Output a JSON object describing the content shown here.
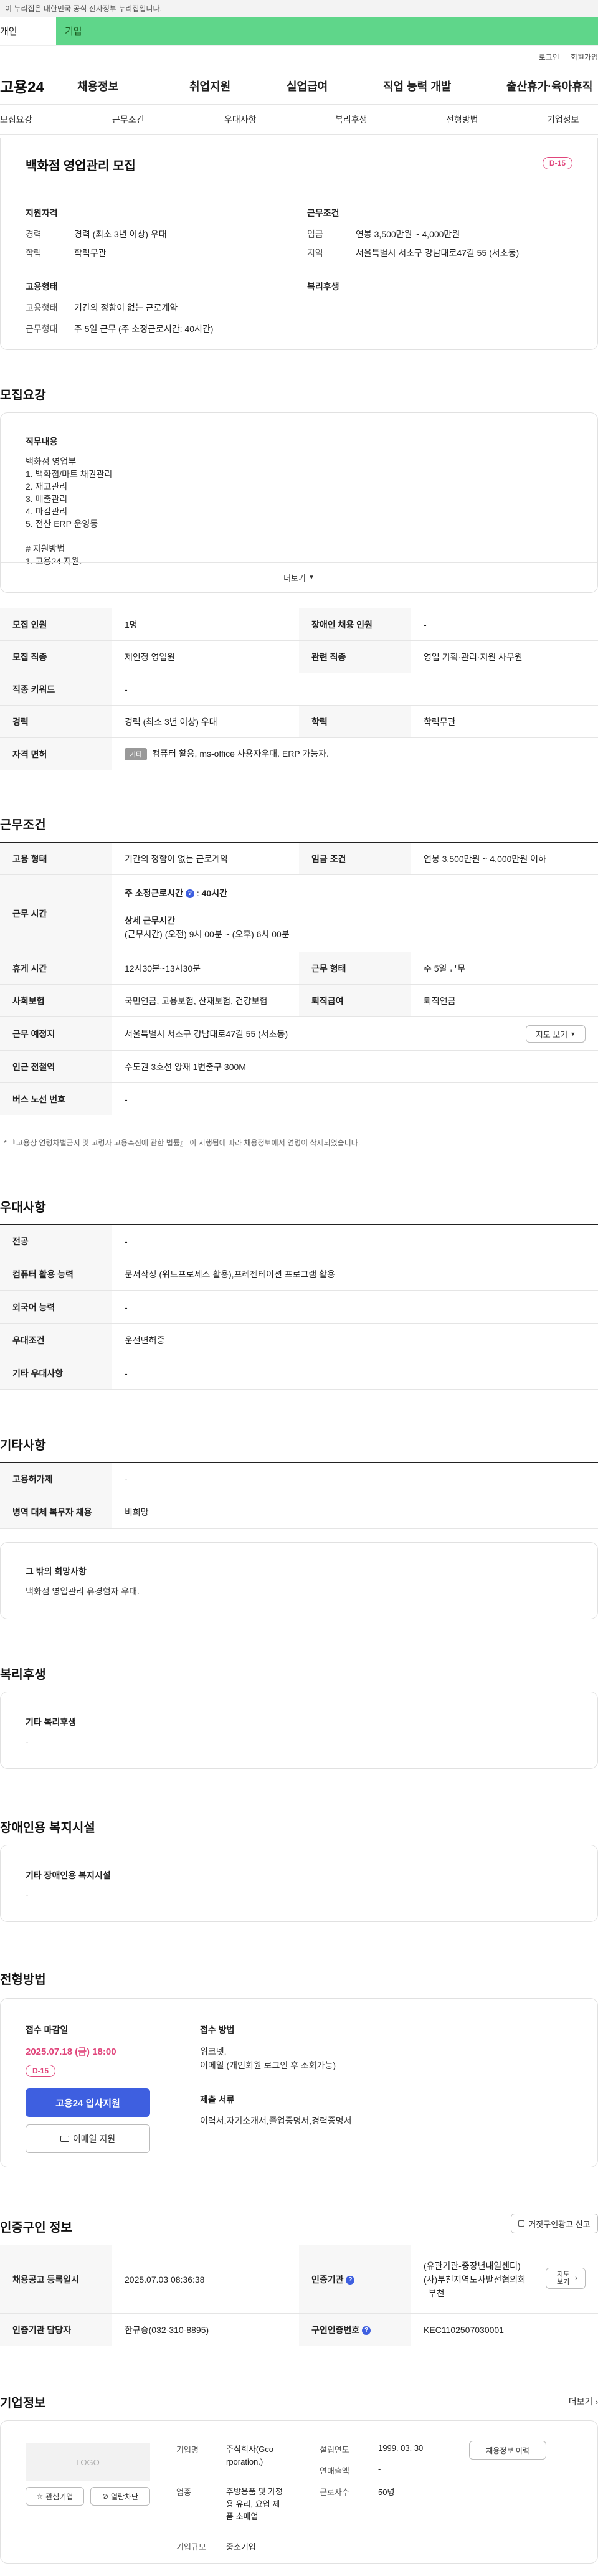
{
  "gov_banner": "이 누리집은 대한민국 공식 전자정부 누리집입니다.",
  "top_tabs": [
    {
      "label": "개인"
    },
    {
      "label": "기업"
    }
  ],
  "util_links": {
    "login": "로그인",
    "signup": "회원가입"
  },
  "gnb": {
    "logo": "고용24",
    "items": [
      "채용정보",
      "취업지원",
      "실업급여",
      "직업 능력 개발",
      "출산휴가·육아휴직"
    ]
  },
  "subnav": [
    "모집요강",
    "근무조건",
    "우대사항",
    "복리후생",
    "전형방법",
    "기업정보"
  ],
  "summary": {
    "title": "백화점 영업관리 모집",
    "dday": "D-15",
    "qualification_heading": "지원자격",
    "conditions_heading": "근무조건",
    "employment_heading": "고용형태",
    "welfare_heading": "복리후생",
    "qual_rows": [
      {
        "k": "경력",
        "v": "경력 (최소 3년 이상) 우대"
      },
      {
        "k": "학력",
        "v": "학력무관"
      }
    ],
    "cond_rows": [
      {
        "k": "임금",
        "v": "연봉 3,500만원 ~ 4,000만원"
      },
      {
        "k": "지역",
        "v": "서울특별시 서초구 강남대로47길 55 (서초동)"
      }
    ],
    "emp_rows": [
      {
        "k": "고용형태",
        "v": "기간의 정함이 없는 근로계약"
      },
      {
        "k": "근무형태",
        "v": "주 5일 근무 (주 소정근로시간: 40시간)"
      }
    ]
  },
  "recruit": {
    "heading": "모집요강",
    "duty_heading": "직무내용",
    "duty_lines": [
      "백화점 영업부",
      "1. 백화점/마트 채권관리",
      "2. 재고관리",
      "3. 매출관리",
      "4. 마감관리",
      "5. 전산 ERP 운영등",
      "",
      "# 지원방법",
      "1. 고용24 지원."
    ],
    "more": "더보기",
    "rows": [
      {
        "k": "모집 인원",
        "v": "1명",
        "k2": "장애인 채용 인원",
        "v2": "-"
      },
      {
        "k": "모집 직종",
        "v": "제인정 영업원",
        "k2": "관련 직종",
        "v2": "영업 기획·관리·지원 사무원"
      },
      {
        "k": "직종 키워드",
        "v": "-"
      },
      {
        "k": "경력",
        "v": "경력 (최소 3년 이상) 우대",
        "k2": "학력",
        "v2": "학력무관"
      },
      {
        "k": "자격 면허",
        "badge": "기타",
        "v": "컴퓨터 활용, ms-office 사용자우대. ERP 가능자."
      }
    ]
  },
  "conditions": {
    "heading": "근무조건",
    "employment_type_k": "고용 형태",
    "employment_type_v": "기간의 정함이 없는 근로계약",
    "wage_k": "임금 조건",
    "wage_v": "연봉 3,500만원 ~ 4,000만원 이하",
    "hours_k": "근무 시간",
    "weekly_label": "주 소정근로시간",
    "weekly_value": "40시간",
    "detail_label": "상세 근무시간",
    "detail_value": "(근무시간) (오전) 9시 00분 ~ (오후) 6시 00분",
    "break_k": "휴게 시간",
    "break_v": "12시30분~13시30분",
    "worktype_k": "근무 형태",
    "worktype_v": "주 5일 근무",
    "insurance_k": "사회보험",
    "insurance_v": "국민연금, 고용보험, 산재보험, 건강보험",
    "severance_k": "퇴직급여",
    "severance_v": "퇴직연금",
    "location_k": "근무 예정지",
    "location_v": "서울특별시 서초구 강남대로47길 55 (서초동)",
    "map_button": "지도 보기",
    "subway_k": "인근 전철역",
    "subway_v": "수도권 3호선 양재 1번출구 300M",
    "bus_k": "버스 노선 번호",
    "bus_v": "-",
    "footnote": "* 『고용상 연령차별금지 및 고령자 고용촉진에 관한 법률』 이 시행됨에 따라 채용정보에서 연령이 삭제되었습니다."
  },
  "preferences": {
    "heading": "우대사항",
    "rows": [
      {
        "k": "전공",
        "v": "-"
      },
      {
        "k": "컴퓨터 활용 능력",
        "v": "문서작성 (워드프로세스 활용),프레젠테이션 프로그램 활용"
      },
      {
        "k": "외국어 능력",
        "v": "-"
      },
      {
        "k": "우대조건",
        "v": "운전면허증"
      },
      {
        "k": "기타 우대사항",
        "v": "-"
      }
    ]
  },
  "others": {
    "heading": "기타사항",
    "rows": [
      {
        "k": "고용허가제",
        "v": "-"
      },
      {
        "k": "병역 대체 복무자 채용",
        "v": "비희망"
      }
    ],
    "wish_heading": "그 밖의 희망사항",
    "wish_text": "백화점 영업관리 유경험자 우대."
  },
  "welfare": {
    "heading": "복리후생",
    "sub_heading": "기타 복리후생",
    "value": "-"
  },
  "disabled": {
    "heading": "장애인용 복지시설",
    "sub_heading": "기타 장애인용 복지시설",
    "value": "-"
  },
  "selection": {
    "heading": "전형방법",
    "deadline_label": "접수 마감일",
    "deadline_value": "2025.07.18 (금) 18:00",
    "dday": "D-15",
    "apply_button": "고용24 입사지원",
    "email_button": "이메일 지원",
    "method_label": "접수 방법",
    "method_lines": [
      "워크넷,",
      "이메일 (개인회원 로그인 후 조회가능)"
    ],
    "docs_label": "제출 서류",
    "docs_value": "이력서,자기소개서,졸업증명서,경력증명서"
  },
  "certification": {
    "heading": "인증구인 정보",
    "report_button": "거짓구인광고 신고",
    "rows": [
      {
        "k": "채용공고 등록일시",
        "v": "2025.07.03 08:36:38",
        "k2": "인증기관",
        "v2_lines": [
          "(유관기관-중장년내일센터)",
          "(사)부천지역노사발전협의회",
          "_부천"
        ],
        "map": "지도 보기"
      },
      {
        "k": "인증기관 담당자",
        "v": "한규승(032-310-8895)",
        "k2": "구인인증번호",
        "v2": "KEC1102507030001"
      }
    ]
  },
  "company": {
    "heading": "기업정보",
    "more": "더보기",
    "logo": "LOGO",
    "interest_button": "관심기업",
    "block_button": "열람차단",
    "name_k": "기업명",
    "name_lines": [
      "주식회사(Gco",
      "rporation.)"
    ],
    "founded_k": "설립연도",
    "founded_v": "1999. 03. 30",
    "revenue_k": "연매출액",
    "revenue_v": "-",
    "industry_k": "업종",
    "industry_lines": [
      "주방용품 및 가정",
      "용 유리, 요업 제",
      "품 소매업"
    ],
    "employees_k": "근로자수",
    "employees_v": "50명",
    "size_k": "기업규모",
    "size_v": "중소기업",
    "jobs_button": "채용정보 이력"
  }
}
